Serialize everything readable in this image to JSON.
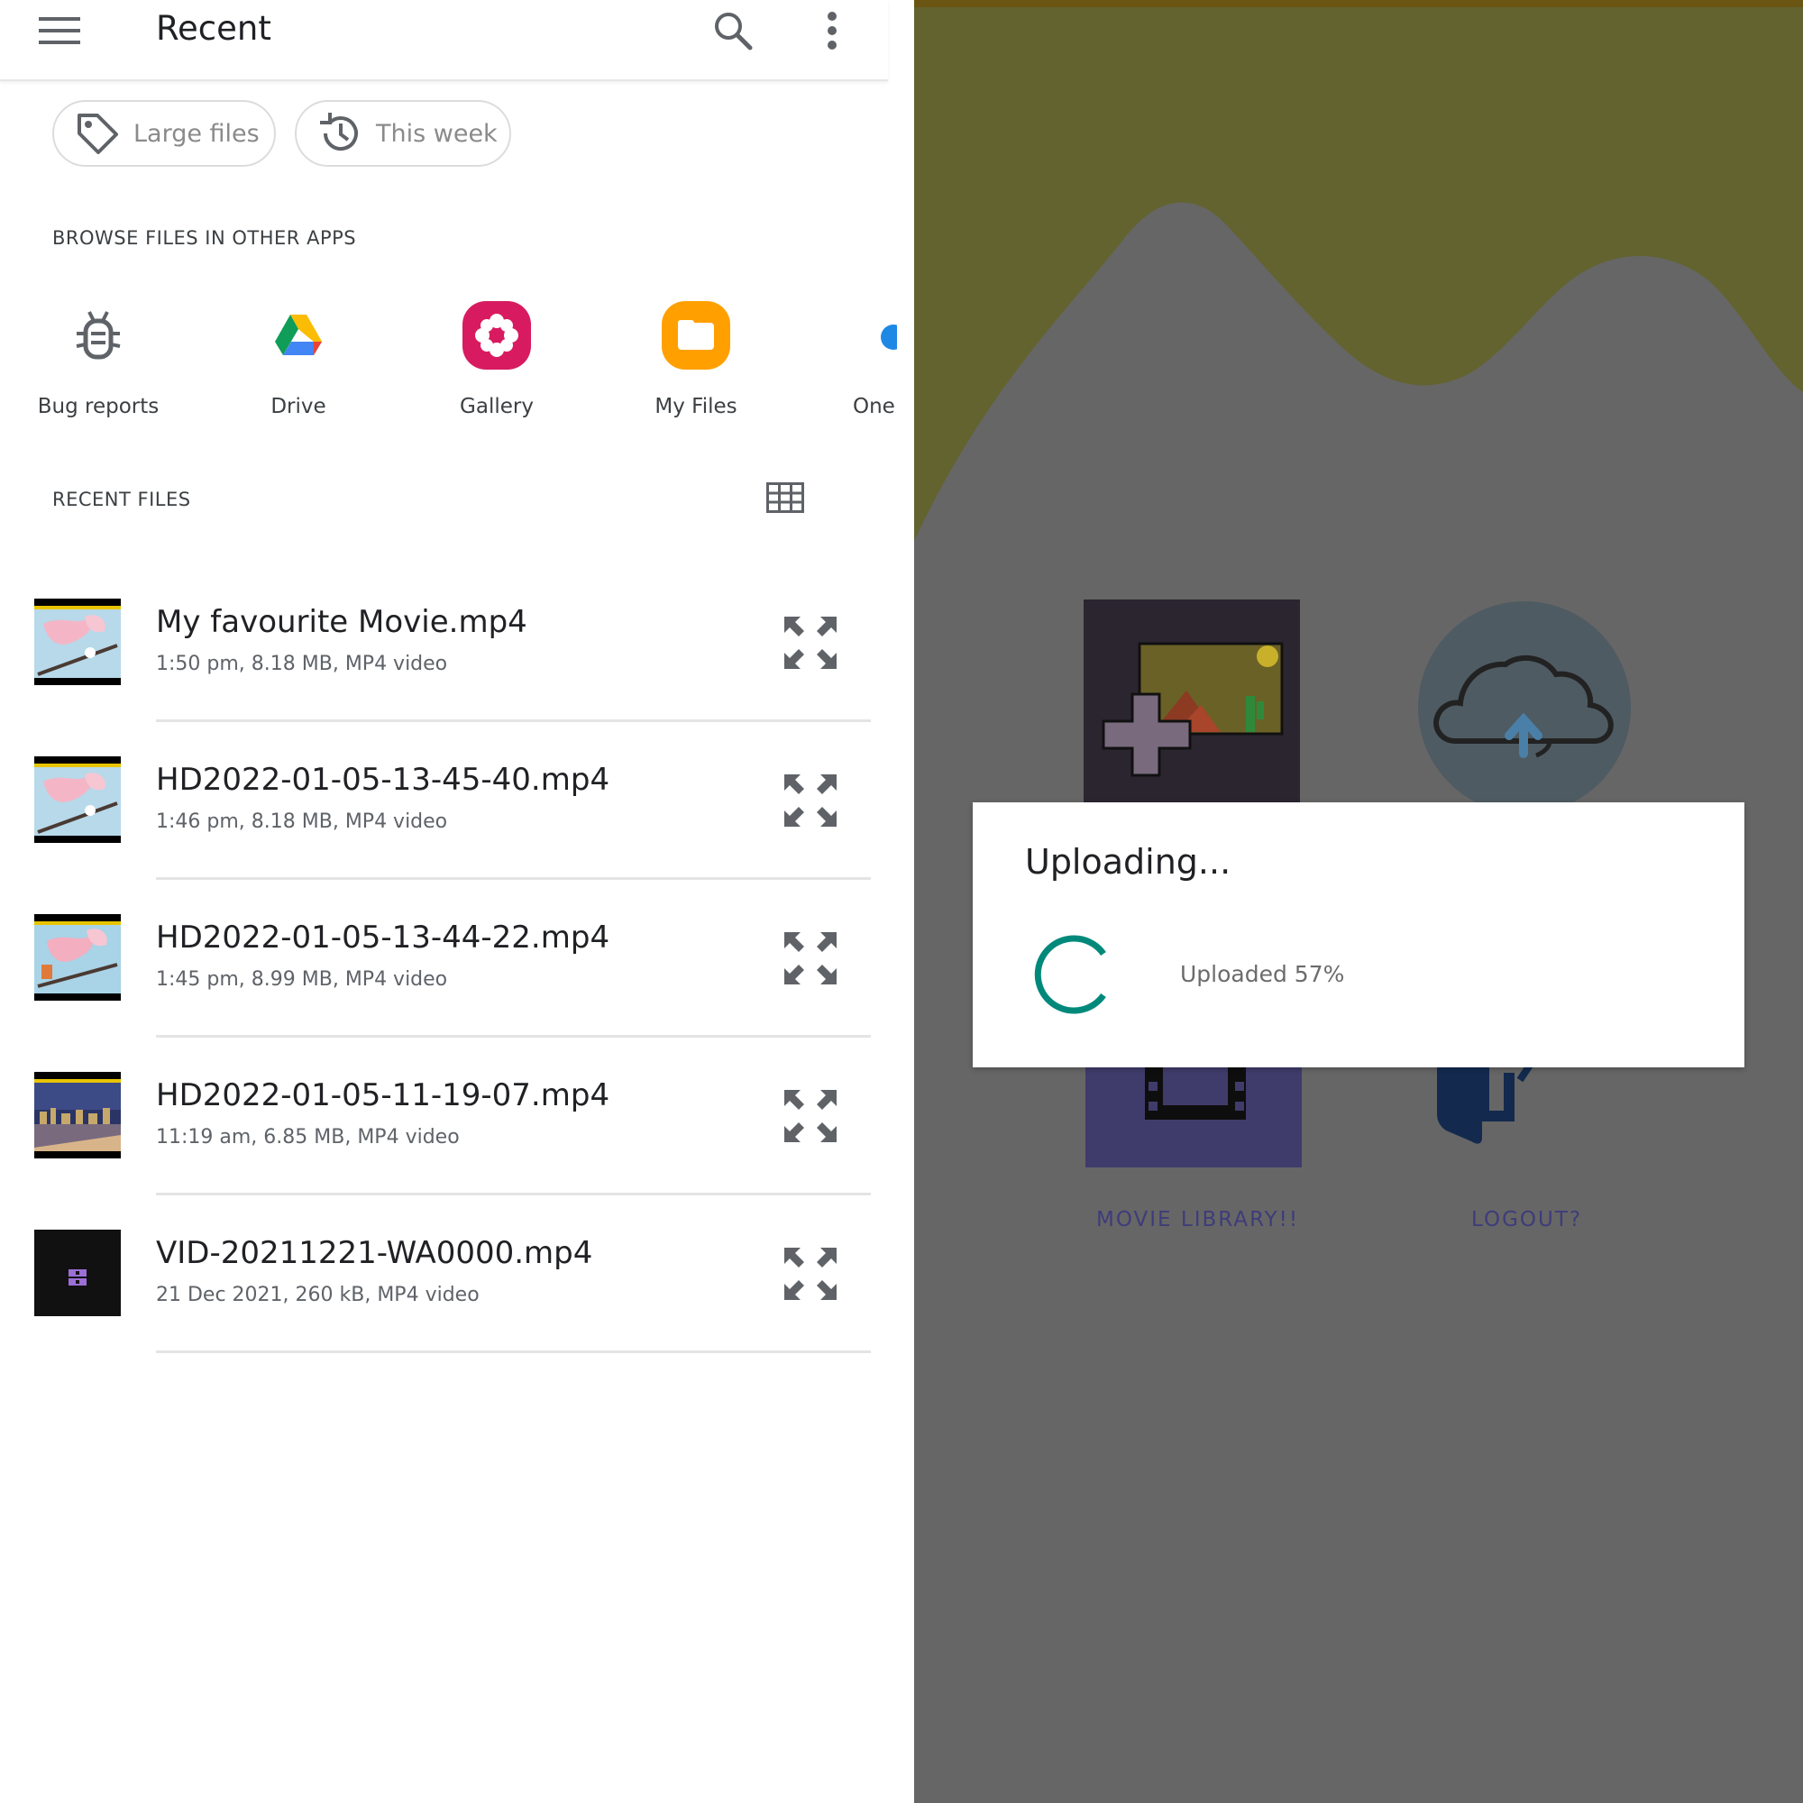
{
  "left_app": {
    "title": "Recent",
    "chips": [
      {
        "label": "Large files",
        "icon": "tag-icon"
      },
      {
        "label": "This week",
        "icon": "history-icon"
      }
    ],
    "browse_header": "BROWSE FILES IN OTHER APPS",
    "apps": [
      {
        "label": "Bug reports",
        "icon": "bug-icon"
      },
      {
        "label": "Drive",
        "icon": "google-drive-icon"
      },
      {
        "label": "Gallery",
        "icon": "gallery-flower-icon"
      },
      {
        "label": "My Files",
        "icon": "folder-icon"
      },
      {
        "label": "One",
        "icon": "onedrive-cloud-icon"
      }
    ],
    "recent_header": "RECENT FILES",
    "files": [
      {
        "name": "My favourite Movie.mp4",
        "meta": "1:50 pm, 8.18 MB, MP4 video"
      },
      {
        "name": "HD2022-01-05-13-45-40.mp4",
        "meta": "1:46 pm, 8.18 MB, MP4 video"
      },
      {
        "name": "HD2022-01-05-13-44-22.mp4",
        "meta": "1:45 pm, 8.99 MB, MP4 video"
      },
      {
        "name": "HD2022-01-05-11-19-07.mp4",
        "meta": "11:19 am, 6.85 MB, MP4 video"
      },
      {
        "name": "VID-20211221-WA0000.mp4",
        "meta": "21 Dec 2021, 260 kB, MP4 video"
      }
    ]
  },
  "right_app": {
    "dialog": {
      "title": "Uploading...",
      "message": "Uploaded 57%",
      "progress_percent": 57
    },
    "tiles": [
      {
        "label": "MOVIE LIBRARY!!",
        "icon": "film-strip-icon"
      },
      {
        "label": "LOGOUT?",
        "icon": "logout-door-icon"
      },
      {
        "label": "",
        "icon": "add-image-icon"
      },
      {
        "label": "",
        "icon": "cloud-upload-icon"
      }
    ]
  },
  "colors": {
    "accent_teal": "#00897b",
    "overlay_gray": "#666666",
    "hill_olive": "#636330",
    "tile_label": "#3e3c7a"
  }
}
